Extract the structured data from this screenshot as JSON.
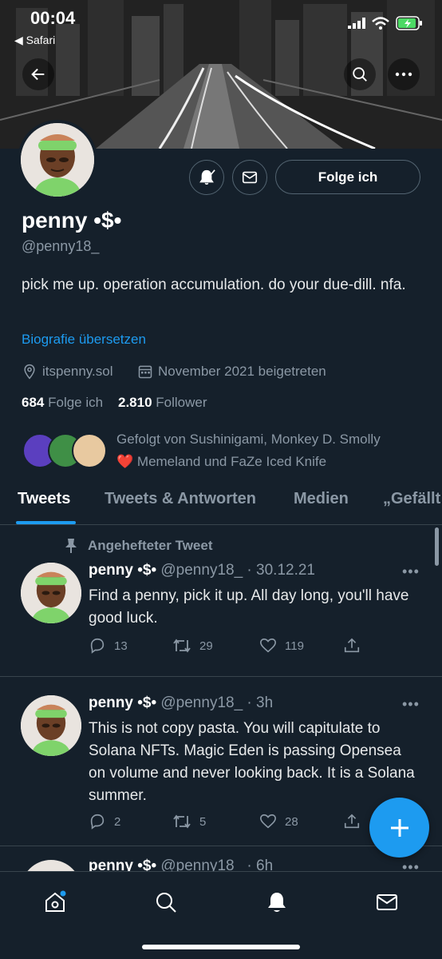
{
  "status_bar": {
    "time": "00:04",
    "back_app": "◀ Safari"
  },
  "profile": {
    "name": "penny •$•",
    "handle": "@penny18_",
    "bio": "pick me up. operation accumulation. do your due-dill. nfa.",
    "translate_label": "Biografie übersetzen",
    "location": "itspenny.sol",
    "joined": "November 2021 beigetreten",
    "following_count": "684",
    "following_label": "Folge ich",
    "followers_count": "2.810",
    "followers_label": "Follower",
    "followed_by_line1": "Gefolgt von Sushinigami, Monkey D. Smolly",
    "followed_by_line2": "Memeland und FaZe Iced Knife",
    "follow_button": "Folge ich"
  },
  "tabs": [
    {
      "label": "Tweets",
      "active": true
    },
    {
      "label": "Tweets & Antworten",
      "active": false
    },
    {
      "label": "Medien",
      "active": false
    },
    {
      "label": "„Gefällt",
      "active": false
    }
  ],
  "pinned_label": "Angehefteter Tweet",
  "tweets": [
    {
      "name": "penny •$•",
      "handle_time": "@penny18_ · 30.12.21",
      "text": "Find a penny, pick it up. All day long, you'll have good luck.",
      "replies": "13",
      "retweets": "29",
      "likes": "119"
    },
    {
      "name": "penny •$•",
      "handle_time": "@penny18_ · 3h",
      "text": "This is not copy pasta. You will capitulate to Solana NFTs. Magic Eden is passing Opensea on volume and never looking back. It is a Solana summer.",
      "replies": "2",
      "retweets": "5",
      "likes": "28"
    },
    {
      "name": "penny •$•",
      "handle_time": "@penny18_ · 6h"
    }
  ],
  "more_glyph": "•••",
  "colors": {
    "accent": "#1d9bf0",
    "background": "#15202b",
    "muted": "#8b98a5",
    "heart": "#f91880"
  }
}
